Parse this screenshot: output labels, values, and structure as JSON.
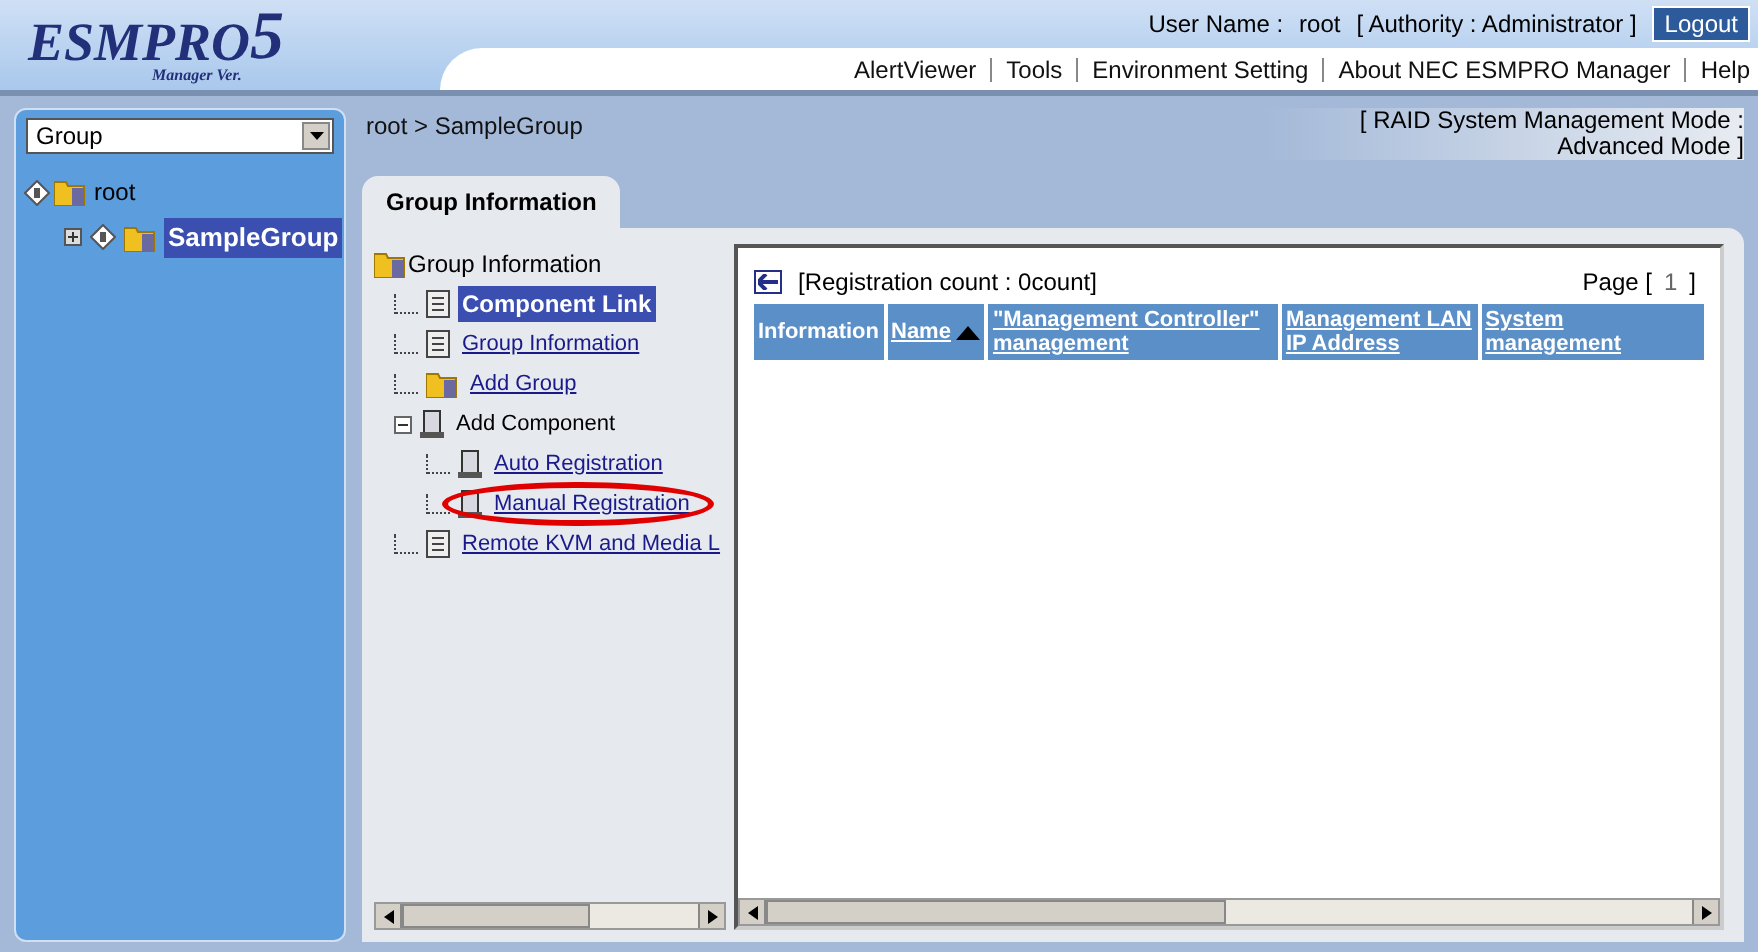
{
  "header": {
    "logo": {
      "name": "ESMPRO",
      "version": "5",
      "subtitle": "Manager Ver."
    },
    "user_label": "User Name :",
    "user": "root",
    "authority": "[ Authority : Administrator ]",
    "logout": "Logout",
    "nav": [
      "AlertViewer",
      "Tools",
      "Environment Setting",
      "About NEC ESMPRO Manager",
      "Help"
    ]
  },
  "sidebar": {
    "dropdown": {
      "value": "Group"
    },
    "tree": [
      {
        "label": "root",
        "selected": false,
        "children": [
          {
            "label": "SampleGroup",
            "selected": true,
            "expanded": false
          }
        ]
      }
    ]
  },
  "breadcrumb": "root > SampleGroup",
  "mode": "[ RAID System Management Mode : Advanced Mode ]",
  "tabs": [
    {
      "label": "Group Information",
      "selected": true
    }
  ],
  "menu": {
    "label": "Group Information",
    "items": [
      {
        "label": "Component Link",
        "kind": "document",
        "selected": true,
        "link": false,
        "circled": false
      },
      {
        "label": "Group Information",
        "kind": "document",
        "selected": false,
        "link": true,
        "circled": false
      },
      {
        "label": "Add Group",
        "kind": "folder",
        "selected": false,
        "link": true,
        "circled": false
      },
      {
        "label": "Add Component",
        "kind": "server",
        "selected": false,
        "link": false,
        "circled": false,
        "expanded": true,
        "children": [
          {
            "label": "Auto Registration",
            "kind": "server",
            "selected": false,
            "link": true,
            "circled": false
          },
          {
            "label": "Manual Registration",
            "kind": "server",
            "selected": false,
            "link": true,
            "circled": true
          }
        ]
      },
      {
        "label": "Remote KVM and Media L",
        "kind": "document",
        "selected": false,
        "link": true,
        "circled": false
      }
    ]
  },
  "table": {
    "count": "[Registration count : 0count]",
    "page_label": "Page [",
    "page": "1",
    "page_end": "]",
    "columns": [
      {
        "label": "Information",
        "link": false,
        "sorted": false
      },
      {
        "label": "Name",
        "link": true,
        "sorted": true
      },
      {
        "label": "\"Management Controller\" management",
        "link": true,
        "sorted": false
      },
      {
        "label": "Management LAN IP Address",
        "link": true,
        "sorted": false
      },
      {
        "label": "System management",
        "link": true,
        "sorted": false
      }
    ]
  }
}
